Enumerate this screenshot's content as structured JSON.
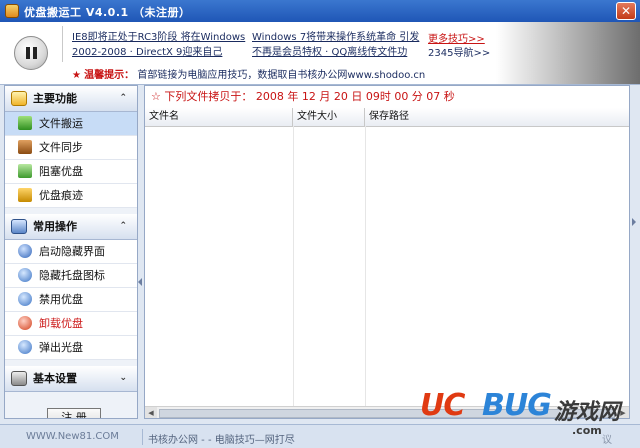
{
  "window": {
    "title": "优盘搬运工 V4.0.1    （未注册）",
    "close_glyph": "✕"
  },
  "header": {
    "news": [
      "IE8即将正处于RC3阶段 将在Windows",
      "Windows 7将带来操作系统革命 引发",
      "2002-2008 · DirectX 9迎来自己",
      "不再是会员特权 · QQ离线传文件功"
    ],
    "more_tips": "更多技巧>>",
    "nav_2345": "2345导航>>",
    "notice_star": "★",
    "notice_label": "温馨提示：",
    "notice_text": "首部链接为电脑应用技巧，数据取自书核办公网www.shodoo.cn"
  },
  "sidebar": {
    "sections": [
      {
        "title": "主要功能",
        "chevron": "⌃",
        "items": [
          {
            "label": "文件搬运"
          },
          {
            "label": "文件同步"
          },
          {
            "label": "阻塞优盘"
          },
          {
            "label": "优盘痕迹"
          }
        ]
      },
      {
        "title": "常用操作",
        "chevron": "⌃",
        "items": [
          {
            "label": "启动隐藏界面"
          },
          {
            "label": "隐藏托盘图标"
          },
          {
            "label": "禁用优盘"
          },
          {
            "label": "卸载优盘"
          },
          {
            "label": "弹出光盘"
          }
        ]
      },
      {
        "title": "基本设置",
        "chevron": "⌄",
        "items": []
      }
    ],
    "register_label": "注 册"
  },
  "main": {
    "copy_header": "☆ 下列文件拷贝于： 2008 年 12 月 20 日 09时 00 分 07 秒",
    "columns": [
      "文件名",
      "文件大小",
      "保存路径"
    ]
  },
  "statusbar": {
    "left": "WWW.New81.COM",
    "center": "书核办公网 - - 电脑技巧—网打尽",
    "tail": "议"
  },
  "watermark": {
    "uc": "UC",
    "bug": "BUG",
    "cn": "游戏网",
    "com": ".com"
  },
  "colors": {
    "accent_red": "#c81414",
    "titlebar_blue": "#2a63c2",
    "selected_row": "#c7dcf6"
  }
}
